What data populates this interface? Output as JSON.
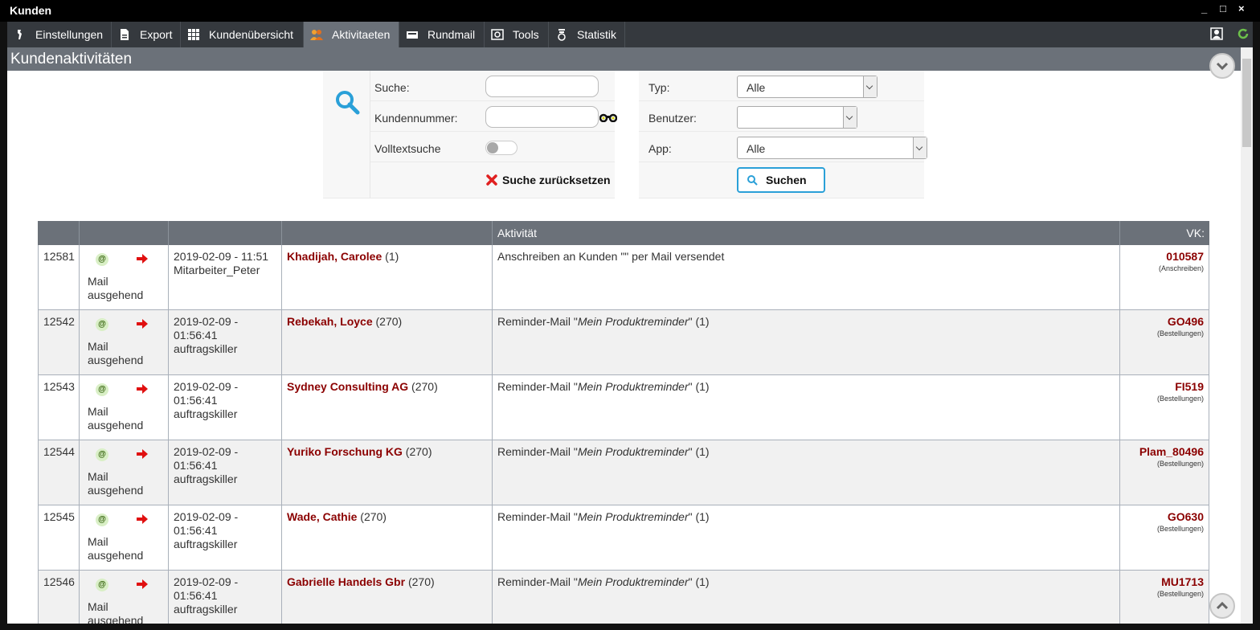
{
  "window": {
    "title": "Kunden",
    "controls": [
      "_",
      "□",
      "×"
    ]
  },
  "menu": [
    {
      "label": "Einstellungen",
      "icon": "wrench-icon"
    },
    {
      "label": "Export",
      "icon": "document-icon"
    },
    {
      "label": "Kundenübersicht",
      "icon": "grid-icon"
    },
    {
      "label": "Aktivitaeten",
      "icon": "people-icon",
      "active": true
    },
    {
      "label": "Rundmail",
      "icon": "mail-card-icon"
    },
    {
      "label": "Tools",
      "icon": "tools-icon"
    },
    {
      "label": "Statistik",
      "icon": "statistic-icon"
    }
  ],
  "page": {
    "title": "Kundenaktivitäten"
  },
  "search": {
    "suche_label": "Suche:",
    "suche_value": "",
    "kundennummer_label": "Kundennummer:",
    "kundennummer_value": "",
    "volltext_label": "Volltextsuche",
    "volltext_on": false,
    "reset_label": "Suche zurücksetzen",
    "typ_label": "Typ:",
    "typ_value": "Alle",
    "benutzer_label": "Benutzer:",
    "benutzer_value": "",
    "app_label": "App:",
    "app_value": "Alle",
    "search_button": "Suchen"
  },
  "table": {
    "headers": [
      "",
      "",
      "",
      "",
      "Aktivität",
      "VK:"
    ],
    "rows": [
      {
        "id": "12581",
        "type_line1": "Mail",
        "type_line2": "ausgehend",
        "date": "2019-02-09 - 11:51",
        "date2": "",
        "user": "Mitarbeiter_Peter",
        "customer": "Khadijah, Carolee",
        "count": "(1)",
        "activity": "Anschreiben an Kunden \"\" per Mail versendet",
        "activity_italic": "",
        "activity_suffix": "",
        "ref": "010587",
        "ref_sub": "(Anschreiben)"
      },
      {
        "id": "12542",
        "type_line1": "Mail",
        "type_line2": "ausgehend",
        "date": "2019-02-09 -",
        "date2": "01:56:41",
        "user": "auftragskiller",
        "customer": "Rebekah, Loyce",
        "count": "(270)",
        "activity": "Reminder-Mail \"",
        "activity_italic": "Mein Produktreminder",
        "activity_suffix": "\" (1)",
        "ref": "GO496",
        "ref_sub": "(Bestellungen)"
      },
      {
        "id": "12543",
        "type_line1": "Mail",
        "type_line2": "ausgehend",
        "date": "2019-02-09 -",
        "date2": "01:56:41",
        "user": "auftragskiller",
        "customer": "Sydney Consulting AG",
        "count": "(270)",
        "activity": "Reminder-Mail \"",
        "activity_italic": "Mein Produktreminder",
        "activity_suffix": "\" (1)",
        "ref": "FI519",
        "ref_sub": "(Bestellungen)"
      },
      {
        "id": "12544",
        "type_line1": "Mail",
        "type_line2": "ausgehend",
        "date": "2019-02-09 -",
        "date2": "01:56:41",
        "user": "auftragskiller",
        "customer": "Yuriko Forschung KG",
        "count": "(270)",
        "activity": "Reminder-Mail \"",
        "activity_italic": "Mein Produktreminder",
        "activity_suffix": "\" (1)",
        "ref": "Plam_80496",
        "ref_sub": "(Bestellungen)"
      },
      {
        "id": "12545",
        "type_line1": "Mail",
        "type_line2": "ausgehend",
        "date": "2019-02-09 -",
        "date2": "01:56:41",
        "user": "auftragskiller",
        "customer": "Wade, Cathie",
        "count": "(270)",
        "activity": "Reminder-Mail \"",
        "activity_italic": "Mein Produktreminder",
        "activity_suffix": "\" (1)",
        "ref": "GO630",
        "ref_sub": "(Bestellungen)"
      },
      {
        "id": "12546",
        "type_line1": "Mail",
        "type_line2": "ausgehend",
        "date": "2019-02-09 -",
        "date2": "01:56:41",
        "user": "auftragskiller",
        "customer": "Gabrielle Handels Gbr",
        "count": "(270)",
        "activity": "Reminder-Mail \"",
        "activity_italic": "Mein Produktreminder",
        "activity_suffix": "\" (1)",
        "ref": "MU1713",
        "ref_sub": "(Bestellungen)"
      }
    ]
  },
  "colors": {
    "accent_header": "#6b7179",
    "menubar": "#35393e",
    "customer_link": "#8b0000",
    "search_icon": "#2aa0d8"
  }
}
